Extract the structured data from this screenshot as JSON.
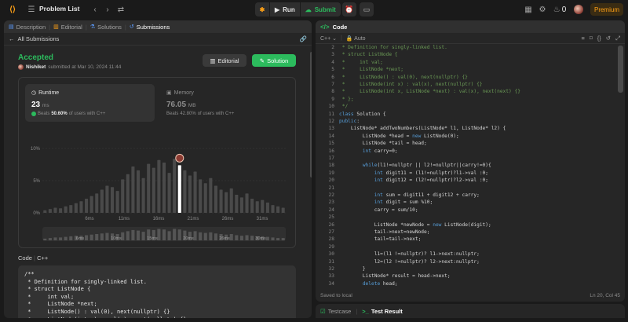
{
  "topbar": {
    "title": "Problem List",
    "run_label": "Run",
    "submit_label": "Submit",
    "streak_count": "0",
    "premium_label": "Premium"
  },
  "left": {
    "tabs": [
      {
        "label": "Description"
      },
      {
        "label": "Editorial"
      },
      {
        "label": "Solutions"
      },
      {
        "label": "Submissions"
      }
    ],
    "back_label": "All Submissions",
    "status": "Accepted",
    "user": "Nishiket",
    "submitted_text": "submitted at Mar 10, 2024 11:44",
    "editorial_button": "Editorial",
    "solution_button": "Solution",
    "runtime": {
      "title": "Runtime",
      "value": "23",
      "unit": "ms",
      "beats_prefix": "Beats",
      "beats_pct": "50.60%",
      "beats_suffix": "of users with C++"
    },
    "memory": {
      "title": "Memory",
      "value": "76.05",
      "unit": "MB",
      "beats_prefix": "Beats",
      "beats_pct": "42.80%",
      "beats_suffix": "of users with C++"
    },
    "code_label": "Code",
    "code_lang": "C++",
    "code_preview": "/**\n * Definition for singly-linked list.\n * struct ListNode {\n *     int val;\n *     ListNode *next;\n *     ListNode() : val(0), next(nullptr) {}\n *     ListNode(int x) : val(x), next(nullptr) {}\n *     ListNode(int x, ListNode *next) : val(x), next(next) {}\n * };"
  },
  "chart_data": {
    "type": "bar",
    "y_ticks": [
      "10%",
      "5%",
      "0%"
    ],
    "ylim": [
      0,
      10
    ],
    "x_ticks": [
      "6ms",
      "11ms",
      "16ms",
      "21ms",
      "26ms",
      "31ms"
    ],
    "mini_x_ticks": [
      "6ms",
      "10ms",
      "15ms",
      "20ms",
      "26ms",
      "30ms"
    ],
    "highlight_index": 26,
    "values": [
      0.4,
      0.6,
      0.8,
      0.7,
      1.0,
      1.2,
      1.5,
      1.8,
      2.2,
      2.6,
      3.0,
      3.6,
      4.2,
      4.0,
      3.4,
      5.2,
      6.0,
      7.2,
      6.6,
      5.4,
      7.6,
      7.0,
      8.2,
      7.8,
      6.2,
      8.4,
      7.4,
      6.6,
      5.8,
      6.4,
      5.2,
      4.6,
      5.4,
      4.2,
      3.6,
      3.2,
      3.8,
      2.8,
      2.4,
      3.0,
      2.2,
      1.8,
      2.0,
      1.6,
      1.2,
      1.0,
      0.8
    ],
    "mini_values": [
      0.3,
      0.4,
      0.5,
      0.5,
      0.6,
      0.7,
      0.8,
      0.8,
      0.9,
      1.0,
      1.1,
      1.2,
      1.3,
      1.2,
      1.1,
      1.4,
      1.6,
      1.8,
      1.7,
      1.5,
      1.9,
      1.8,
      2.0,
      1.9,
      1.6,
      2.0,
      1.9,
      1.7,
      1.5,
      1.6,
      1.4,
      1.3,
      1.4,
      1.2,
      1.1,
      1.0,
      1.1,
      0.9,
      0.8,
      0.9,
      0.8,
      0.7,
      0.7,
      0.6,
      0.5,
      0.4,
      0.4
    ]
  },
  "editor": {
    "title": "Code",
    "language": "C++",
    "mode": "Auto",
    "saved": "Saved to local",
    "cursor": "Ln 20, Col 45",
    "lines": [
      {
        "n": "2",
        "t": " * Definition for singly-linked list."
      },
      {
        "n": "3",
        "t": " * struct ListNode {"
      },
      {
        "n": "4",
        "t": " *     int val;"
      },
      {
        "n": "5",
        "t": " *     ListNode *next;"
      },
      {
        "n": "6",
        "t": " *     ListNode() : val(0), next(nullptr) {}"
      },
      {
        "n": "7",
        "t": " *     ListNode(int x) : val(x), next(nullptr) {}"
      },
      {
        "n": "8",
        "t": " *     ListNode(int x, ListNode *next) : val(x), next(next) {}"
      },
      {
        "n": "9",
        "t": " * };"
      },
      {
        "n": "10",
        "t": " */"
      },
      {
        "n": "11",
        "t": "class Solution {"
      },
      {
        "n": "12",
        "t": "public:"
      },
      {
        "n": "13",
        "t": "    ListNode* addTwoNumbers(ListNode* l1, ListNode* l2) {"
      },
      {
        "n": "14",
        "t": "        ListNode *head = new ListNode(0);"
      },
      {
        "n": "15",
        "t": "        ListNode *tail = head;"
      },
      {
        "n": "16",
        "t": "        int carry=0;"
      },
      {
        "n": "17",
        "t": ""
      },
      {
        "n": "18",
        "t": "        while(l1!=nullptr || l2!=nullptr||carry!=0){"
      },
      {
        "n": "19",
        "t": "            int digit11 = (l1!=nullptr)?l1->val :0;"
      },
      {
        "n": "20",
        "t": "            int digit12 = (l2!=nullptr)?l2->val :0;"
      },
      {
        "n": "21",
        "t": ""
      },
      {
        "n": "22",
        "t": "            int sum = digit11 + digit12 + carry;"
      },
      {
        "n": "23",
        "t": "            int digit = sum %10;"
      },
      {
        "n": "24",
        "t": "            carry = sum/10;"
      },
      {
        "n": "25",
        "t": ""
      },
      {
        "n": "26",
        "t": "            ListNode *newNode = new ListNode(digit);"
      },
      {
        "n": "27",
        "t": "            tail->next=newNode;"
      },
      {
        "n": "28",
        "t": "            tail=tail->next;"
      },
      {
        "n": "29",
        "t": ""
      },
      {
        "n": "30",
        "t": "            l1=(l1 !=nullptr)? l1->next:nullptr;"
      },
      {
        "n": "31",
        "t": "            l2=(l2 !=nullptr)? l2->next:nullptr;"
      },
      {
        "n": "32",
        "t": "        }"
      },
      {
        "n": "33",
        "t": "        ListNode* result = head->next;"
      },
      {
        "n": "34",
        "t": "        delete head;"
      }
    ]
  },
  "bottom": {
    "testcase_label": "Testcase",
    "result_label": "Test Result"
  }
}
